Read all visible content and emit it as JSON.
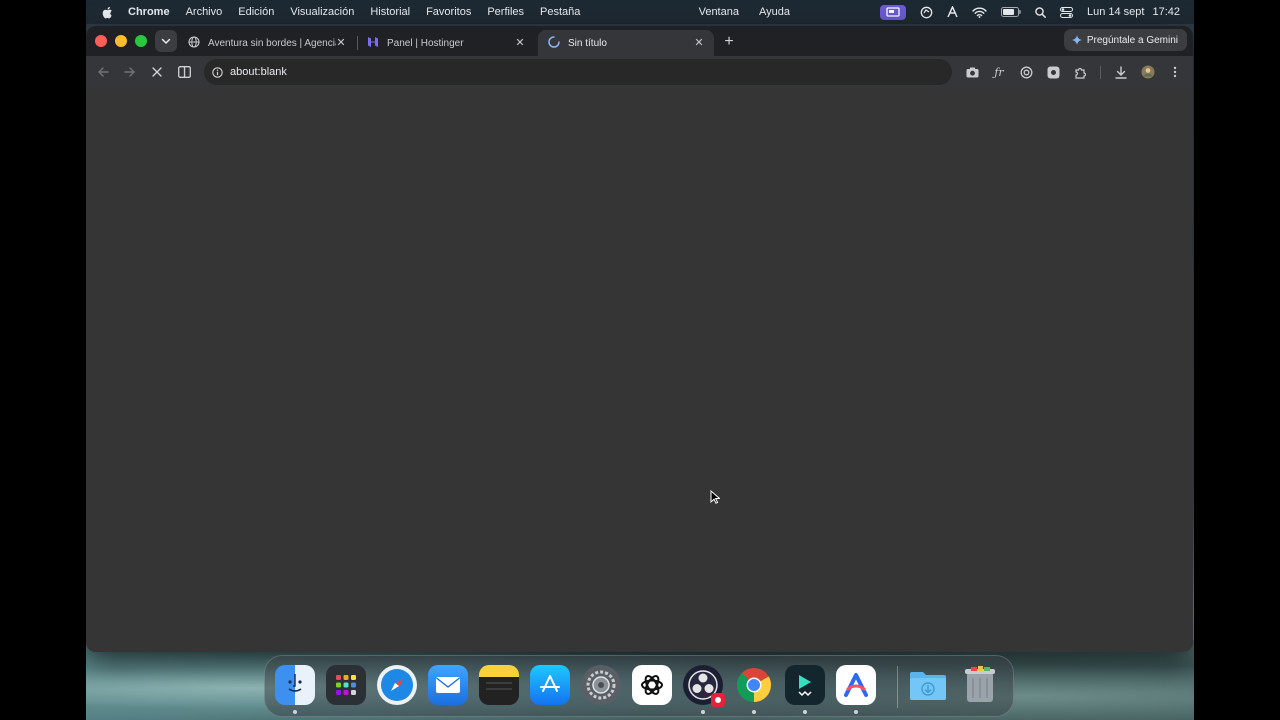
{
  "menubar": {
    "app_name": "Chrome",
    "items": [
      "Archivo",
      "Edición",
      "Visualización",
      "Historial",
      "Favoritos",
      "Perfiles",
      "Pestaña"
    ],
    "right_items": [
      "Ventana",
      "Ayuda"
    ],
    "date": "Lun 14 sept",
    "time": "17:42",
    "status_icons": [
      "screen-mirror-icon",
      "focus-icon",
      "arc-icon",
      "wifi-icon",
      "battery-icon",
      "spotlight-search-icon",
      "control-center-icon"
    ]
  },
  "tabs": [
    {
      "title": "Aventura sin bordes | Agencia",
      "icon": "globe-icon",
      "active": false
    },
    {
      "title": "Panel | Hostinger",
      "icon": "hostinger-icon",
      "active": false
    },
    {
      "title": "Sin título",
      "icon": "loading-spinner-icon",
      "active": true
    }
  ],
  "gemini_button": "Pregúntale a Gemini",
  "omnibox": {
    "url": "about:blank"
  },
  "toolbar_icons": [
    "camera-icon",
    "font-icon",
    "openai-extension-icon",
    "record-extension-icon",
    "extensions-icon",
    "download-icon",
    "profile-avatar-icon",
    "menu-kebab-icon"
  ],
  "dock": {
    "apps": [
      "finder-icon",
      "launchpad-icon",
      "safari-icon",
      "mail-icon",
      "notes-icon",
      "app-store-icon",
      "system-settings-icon",
      "chatgpt-icon",
      "obs-icon",
      "chrome-icon",
      "filmora-icon",
      "arc-app-icon",
      "downloads-folder-icon",
      "trash-icon"
    ]
  },
  "colors": {
    "window_bg": "#353535",
    "tabstrip_bg": "#202124",
    "accent_highlight": "#6b5bd6"
  }
}
